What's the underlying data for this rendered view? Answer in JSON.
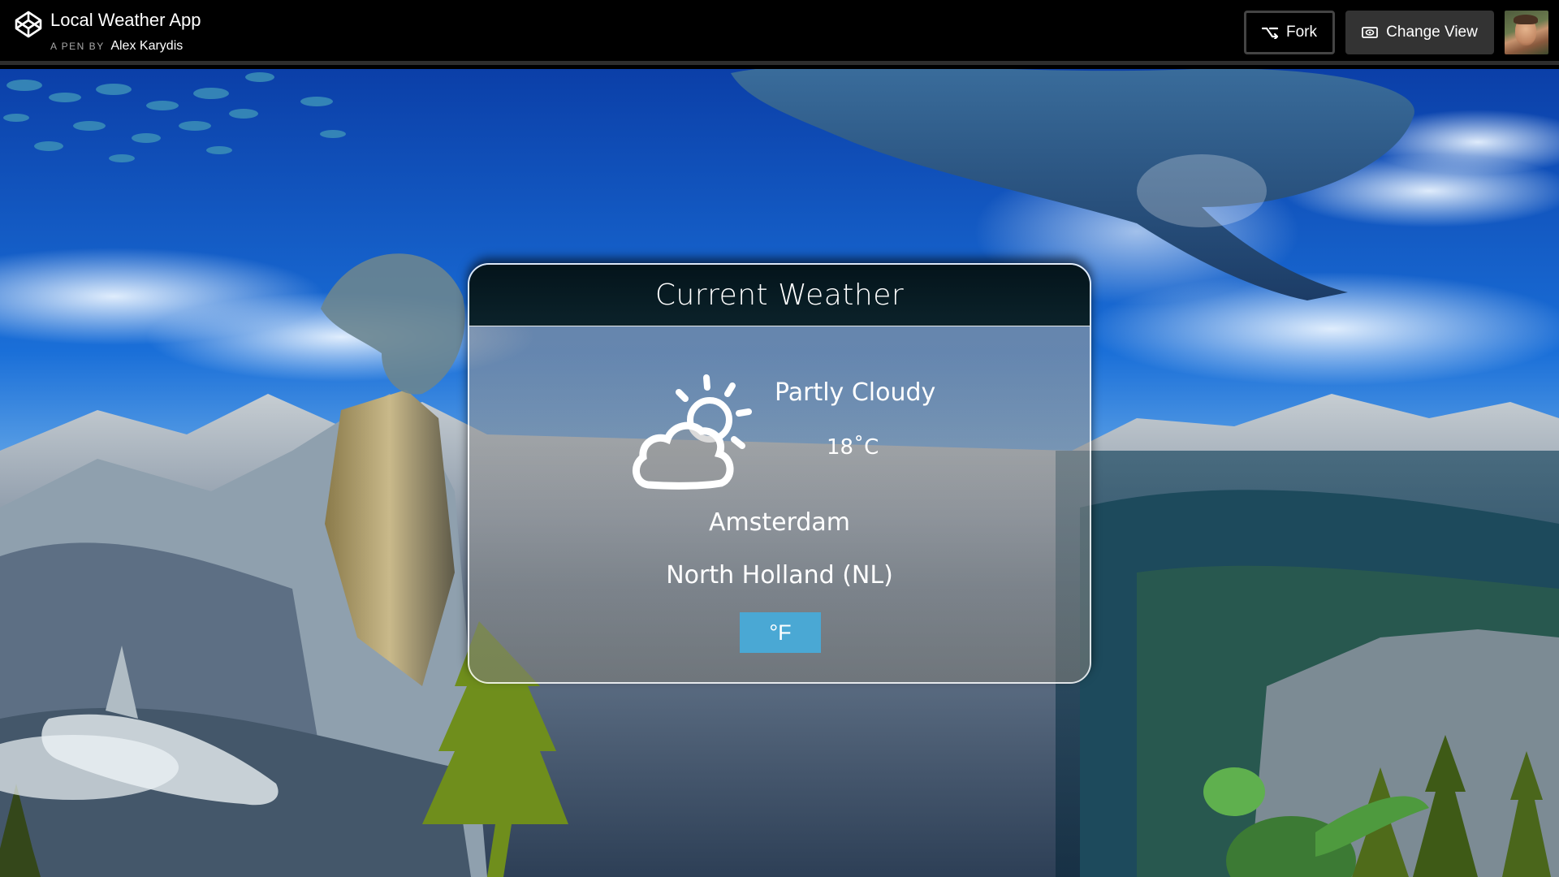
{
  "header": {
    "title": "Local Weather App",
    "byline_prefix": "A PEN BY",
    "author": "Alex Karydis",
    "fork_label": "Fork",
    "change_view_label": "Change View",
    "icons": {
      "logo": "codepen-logo-icon",
      "fork": "fork-icon",
      "view": "eye-frame-icon"
    }
  },
  "weather_card": {
    "title": "Current Weather",
    "condition": "Partly Cloudy",
    "temperature": "18˚C",
    "city": "Amsterdam",
    "region": "North Holland (NL)",
    "unit_toggle_label": "°F",
    "icon": "partly-cloudy-icon"
  },
  "colors": {
    "toggle_button": "#4aa8d4",
    "header_bg": "#000000",
    "card_header_bg": "#06171e"
  }
}
